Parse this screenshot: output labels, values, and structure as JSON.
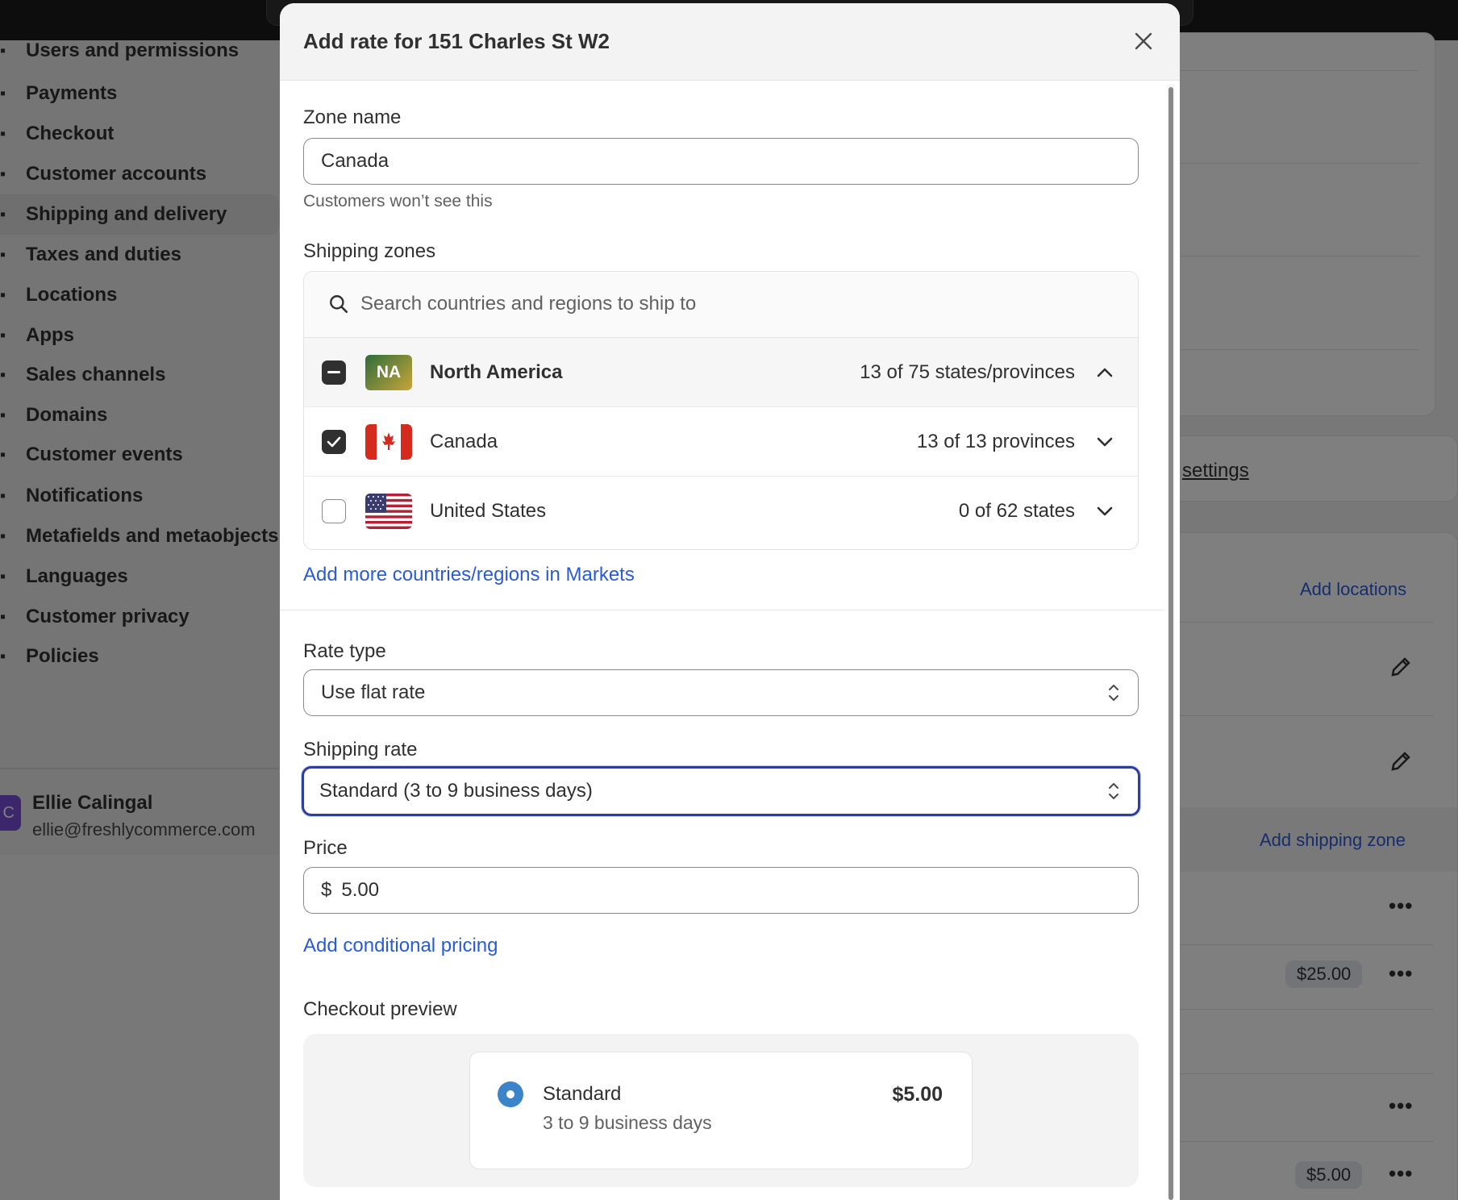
{
  "sidebar": {
    "items": [
      {
        "label": "Users and permissions",
        "icon": "users-icon"
      },
      {
        "label": "Payments",
        "icon": "payments-icon"
      },
      {
        "label": "Checkout",
        "icon": "cart-icon"
      },
      {
        "label": "Customer accounts",
        "icon": "person-icon"
      },
      {
        "label": "Shipping and delivery",
        "icon": "truck-icon"
      },
      {
        "label": "Taxes and duties",
        "icon": "tax-icon"
      },
      {
        "label": "Locations",
        "icon": "location-icon"
      },
      {
        "label": "Apps",
        "icon": "apps-icon"
      },
      {
        "label": "Sales channels",
        "icon": "channels-icon"
      },
      {
        "label": "Domains",
        "icon": "globe-icon"
      },
      {
        "label": "Customer events",
        "icon": "events-icon"
      },
      {
        "label": "Notifications",
        "icon": "bell-icon"
      },
      {
        "label": "Metafields and metaobjects",
        "icon": "metafields-icon"
      },
      {
        "label": "Languages",
        "icon": "language-icon"
      },
      {
        "label": "Customer privacy",
        "icon": "lock-icon"
      },
      {
        "label": "Policies",
        "icon": "document-icon"
      }
    ],
    "user": {
      "initial": "C",
      "name": "Ellie Calingal",
      "email": "ellie@freshlycommerce.com"
    }
  },
  "background": {
    "settings_link": "settings",
    "add_locations": "Add locations",
    "add_shipping_zone": "Add shipping zone",
    "price_pills": [
      "$25.00",
      "$5.00"
    ]
  },
  "modal": {
    "title": "Add rate for 151 Charles St W2",
    "zone_name": {
      "label": "Zone name",
      "value": "Canada",
      "help": "Customers won’t see this"
    },
    "shipping_zones": {
      "label": "Shipping zones",
      "search_placeholder": "Search countries and regions to ship to",
      "rows": [
        {
          "badge": "NA",
          "name": "North America",
          "count": "13 of 75 states/provinces",
          "state": "indeterminate"
        },
        {
          "name": "Canada",
          "count": "13 of 13 provinces",
          "state": "checked"
        },
        {
          "name": "United States",
          "count": "0 of 62 states",
          "state": "unchecked"
        }
      ],
      "add_more_link": "Add more countries/regions in Markets"
    },
    "rate_type": {
      "label": "Rate type",
      "value": "Use flat rate"
    },
    "shipping_rate": {
      "label": "Shipping rate",
      "value": "Standard (3 to 9 business days)"
    },
    "price": {
      "label": "Price",
      "currency": "$",
      "value": "5.00"
    },
    "conditional_link": "Add conditional pricing",
    "checkout_preview": {
      "label": "Checkout preview",
      "name": "Standard",
      "days": "3 to 9 business days",
      "price": "$5.00"
    }
  },
  "colors": {
    "link": "#2a5bd7",
    "focus": "#2c3e9e",
    "radio": "#3c84c9"
  }
}
